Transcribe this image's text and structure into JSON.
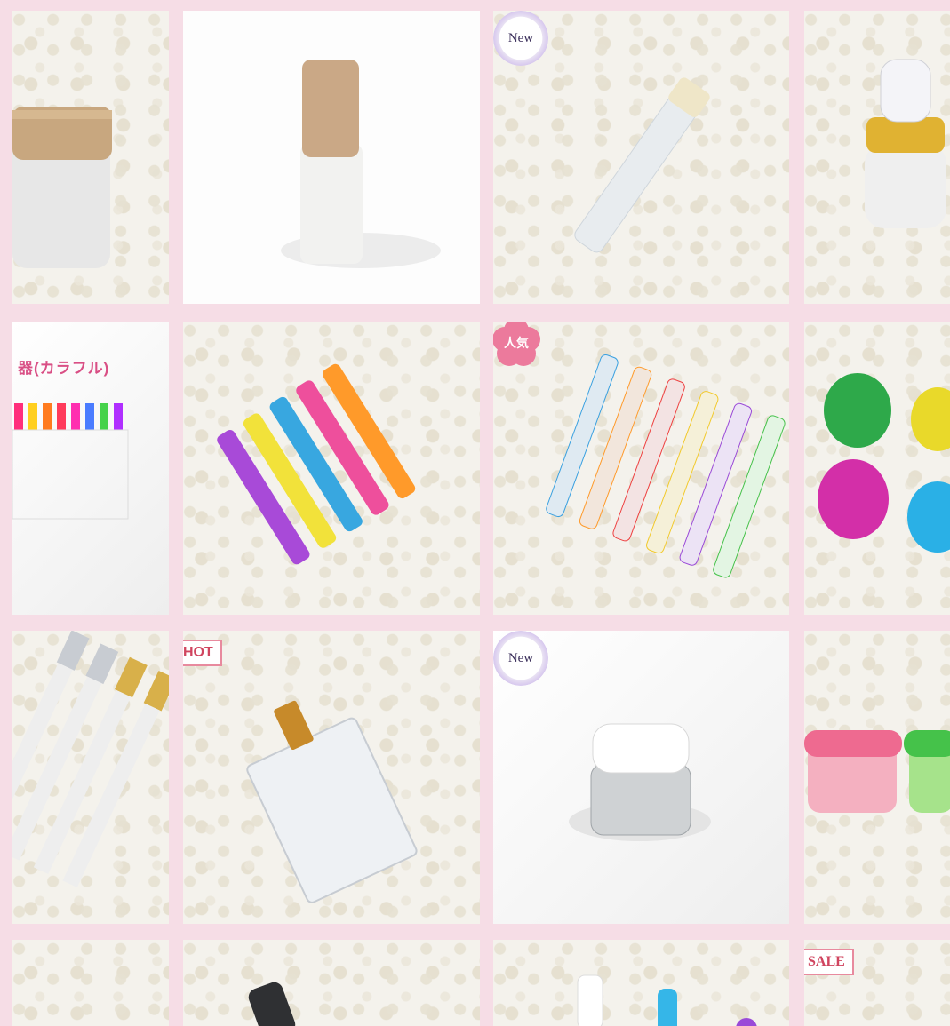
{
  "badges": {
    "new": "New",
    "popular": "人気",
    "hot": "HOT",
    "sale": "SALE"
  },
  "tiles": [
    {
      "name": "frosted-jar-wood-lid"
    },
    {
      "name": "frosted-bottle-wood-cap"
    },
    {
      "name": "clear-dropper-tube",
      "badge": "new"
    },
    {
      "name": "frosted-pump-gold-collar"
    },
    {
      "name": "colorful-atomizer-set",
      "caption": "器(カラフル)"
    },
    {
      "name": "plaid-atomizers"
    },
    {
      "name": "butterfly-atomizers",
      "badge": "popular"
    },
    {
      "name": "apple-perfume-bottles"
    },
    {
      "name": "metal-cap-atomizers"
    },
    {
      "name": "square-perfume-bottle",
      "badge": "hot"
    },
    {
      "name": "glass-jar-white-lid",
      "badge": "new"
    },
    {
      "name": "colored-plastic-jars"
    },
    {
      "name": "fur-background-tile"
    },
    {
      "name": "black-cap-bottle"
    },
    {
      "name": "cream-tubes"
    },
    {
      "name": "sale-item",
      "badge": "sale"
    }
  ],
  "colors": {
    "background": "#f6dde6",
    "accent": "#d94f85"
  }
}
